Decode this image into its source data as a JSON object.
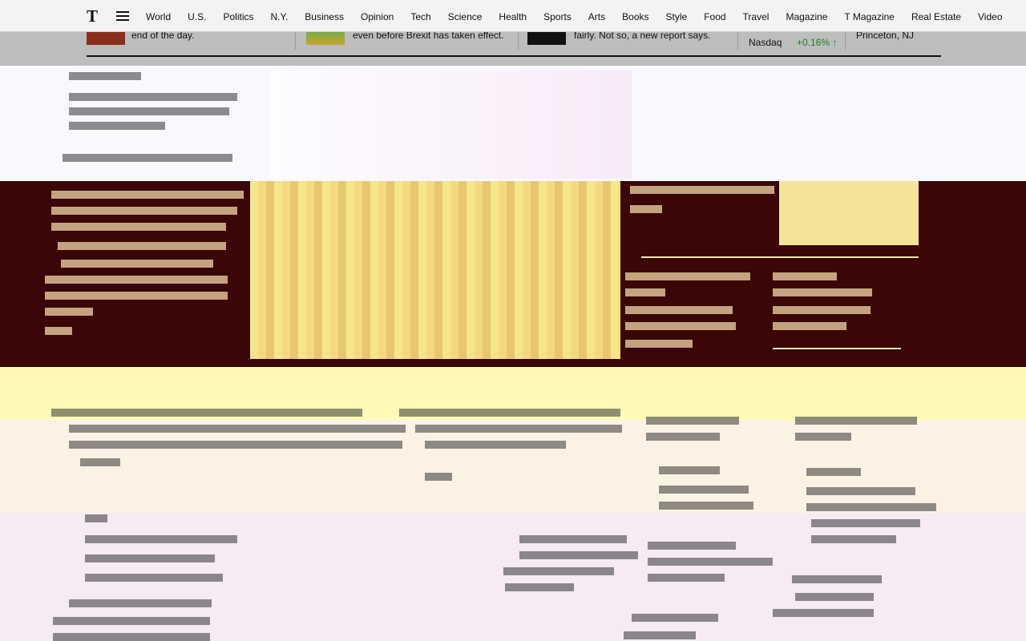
{
  "nav": {
    "sections": [
      "World",
      "U.S.",
      "Politics",
      "N.Y.",
      "Business",
      "Opinion",
      "Tech",
      "Science",
      "Health",
      "Sports",
      "Arts",
      "Books",
      "Style",
      "Food",
      "Travel",
      "Magazine",
      "T Magazine",
      "Real Estate",
      "Video"
    ]
  },
  "ticker": {
    "item1": "end of the day.",
    "item2": "even before Brexit has taken effect.",
    "item3": "fairly. Not so, a new report says.",
    "market_name": "Nasdaq",
    "market_change": "+0.16% ↑",
    "location": "Princeton, NJ"
  },
  "colors": {
    "top_band": "#f8f8ff",
    "dark_band": "#3a0706",
    "yellow_band": "#fffbb7",
    "cream_band": "#fcf2e4",
    "pink_band": "#f6eaf3",
    "ticker_bg": "#bdbdbd",
    "market_up": "#1a7f1a"
  },
  "icons": {
    "logo": "nyt-logo-icon",
    "menu": "hamburger-menu-icon"
  }
}
